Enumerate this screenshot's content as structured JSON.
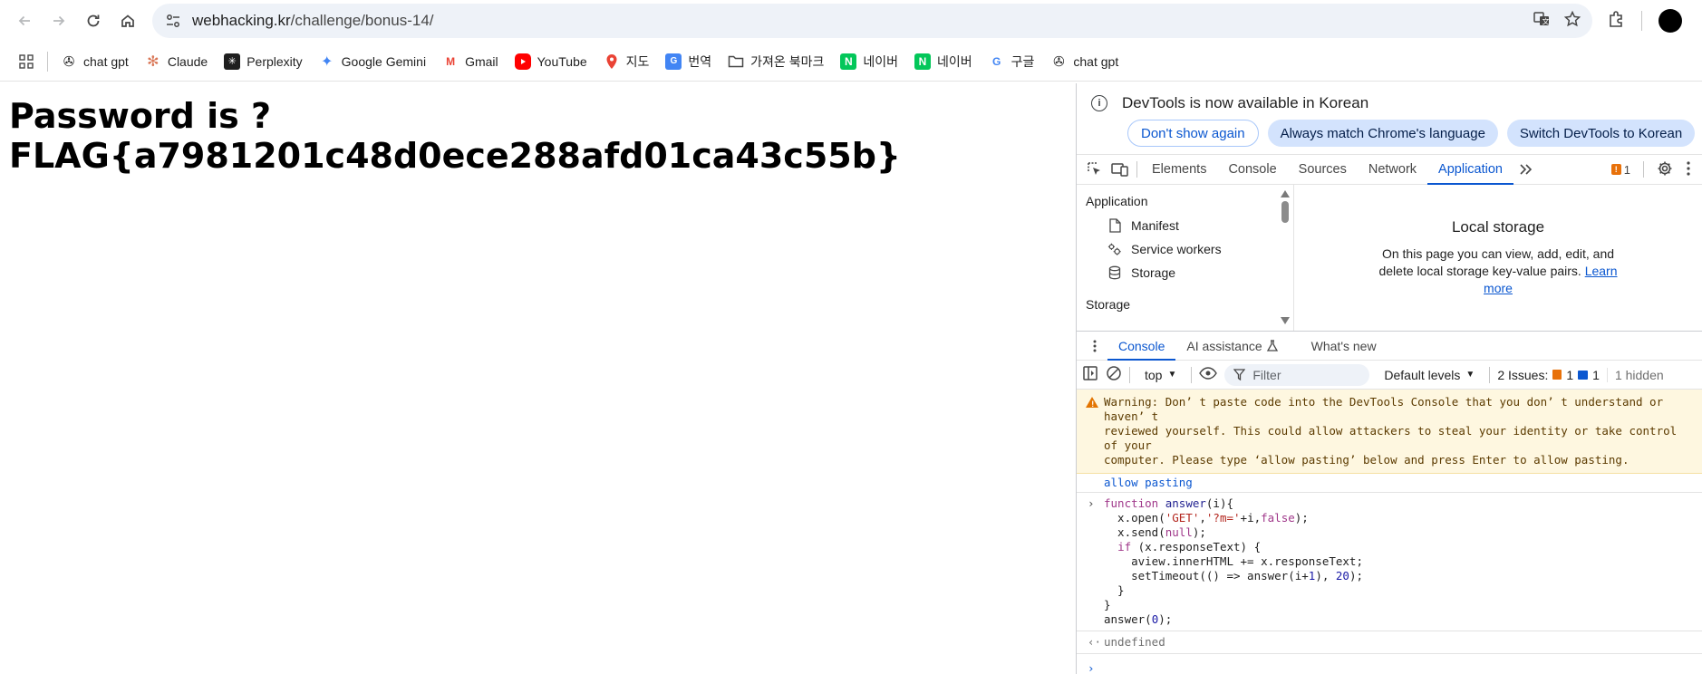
{
  "toolbar": {
    "url_host": "webhacking.kr",
    "url_path": "/challenge/bonus-14/"
  },
  "bookmarks": [
    {
      "label": "chat gpt",
      "icon": "openai-icon",
      "color": "#1f1f1f"
    },
    {
      "label": "Claude",
      "icon": "claude-icon",
      "color": "#d97757"
    },
    {
      "label": "Perplexity",
      "icon": "perplexity-icon",
      "color": "#1f1f1f"
    },
    {
      "label": "Google Gemini",
      "icon": "gemini-icon",
      "color": "#4285f4"
    },
    {
      "label": "Gmail",
      "icon": "gmail-icon",
      "color": "#ea4335"
    },
    {
      "label": "YouTube",
      "icon": "youtube-icon",
      "color": "#ff0000"
    },
    {
      "label": "지도",
      "icon": "maps-icon",
      "color": "#34a853"
    },
    {
      "label": "번역",
      "icon": "translate-icon",
      "color": "#4285f4"
    },
    {
      "label": "가져온 북마크",
      "icon": "folder-icon",
      "color": "#474747"
    },
    {
      "label": "네이버",
      "icon": "naver-icon",
      "color": "#03c75a"
    },
    {
      "label": "네이버",
      "icon": "naver-icon",
      "color": "#03c75a"
    },
    {
      "label": "구글",
      "icon": "google-icon",
      "color": "#4285f4"
    },
    {
      "label": "chat gpt",
      "icon": "openai-icon",
      "color": "#1f1f1f"
    }
  ],
  "page": {
    "heading": "Password is ?FLAG{a7981201c48d0ece288afd01ca43c55b}"
  },
  "devtools": {
    "banner": {
      "message": "DevTools is now available in Korean",
      "btn_dont_show": "Don't show again",
      "btn_match": "Always match Chrome's language",
      "btn_switch": "Switch DevTools to Korean"
    },
    "tabs": [
      "Elements",
      "Console",
      "Sources",
      "Network",
      "Application"
    ],
    "active_tab": "Application",
    "issue_badge": "1",
    "app_sidebar": {
      "heading": "Application",
      "items": [
        "Manifest",
        "Service workers",
        "Storage"
      ],
      "heading2": "Storage"
    },
    "local_storage": {
      "title": "Local storage",
      "desc": "On this page you can view, add, edit, and delete local storage key-value pairs.",
      "link": "Learn more"
    },
    "drawer_tabs": {
      "console": "Console",
      "ai": "AI assistance",
      "whats_new": "What's new"
    },
    "console_toolbar": {
      "context": "top",
      "filter_placeholder": "Filter",
      "levels": "Default levels",
      "issues_label": "2 Issues:",
      "issues_warn": "1",
      "issues_info": "1",
      "hidden": "1 hidden"
    },
    "console": {
      "warning": "Warning: Don’ t paste code into the DevTools Console that you don’ t understand or haven’ t\nreviewed yourself. This could allow attackers to steal your identity or take control of your\ncomputer. Please type  ‘allow pasting’  below and press Enter to allow pasting.",
      "allow_pasting": "allow pasting",
      "result": "undefined"
    }
  }
}
